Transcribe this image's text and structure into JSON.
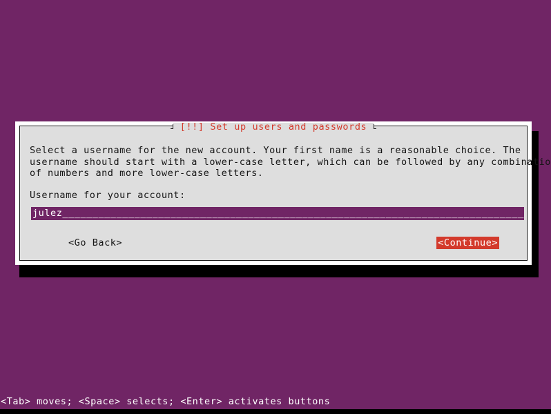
{
  "screen": {
    "background_color": "#702565",
    "foreground_color": "#ffffff"
  },
  "dialog": {
    "title": "[!!] Set up users and passwords",
    "title_color": "#d33a2c",
    "surface_color": "#dedede",
    "frame_color": "#ffffff",
    "border_color": "#1a1a1a",
    "shadow_color": "#000000",
    "body_lines": [
      "Select a username for the new account. Your first name is a reasonable choice. The",
      "username should start with a lower-case letter, which can be followed by any combination",
      "of numbers and more lower-case letters."
    ],
    "field": {
      "label": "Username for your account:",
      "value": "julez______________________________________________________________________________",
      "entered_text": "julez",
      "placeholder": "",
      "background_color": "#702565",
      "text_color": "#ffffff"
    },
    "buttons": [
      {
        "name": "go-back",
        "label": "<Go Back>",
        "focused": false,
        "text_color": "#141414",
        "background_color": "transparent"
      },
      {
        "name": "continue",
        "label": "<Continue>",
        "focused": true,
        "text_color": "#ffffff",
        "background_color": "#d33a2c"
      }
    ]
  },
  "status_bar": {
    "text": "<Tab> moves; <Space> selects; <Enter> activates buttons",
    "background_color": "#702565",
    "text_color": "#ffffff"
  }
}
